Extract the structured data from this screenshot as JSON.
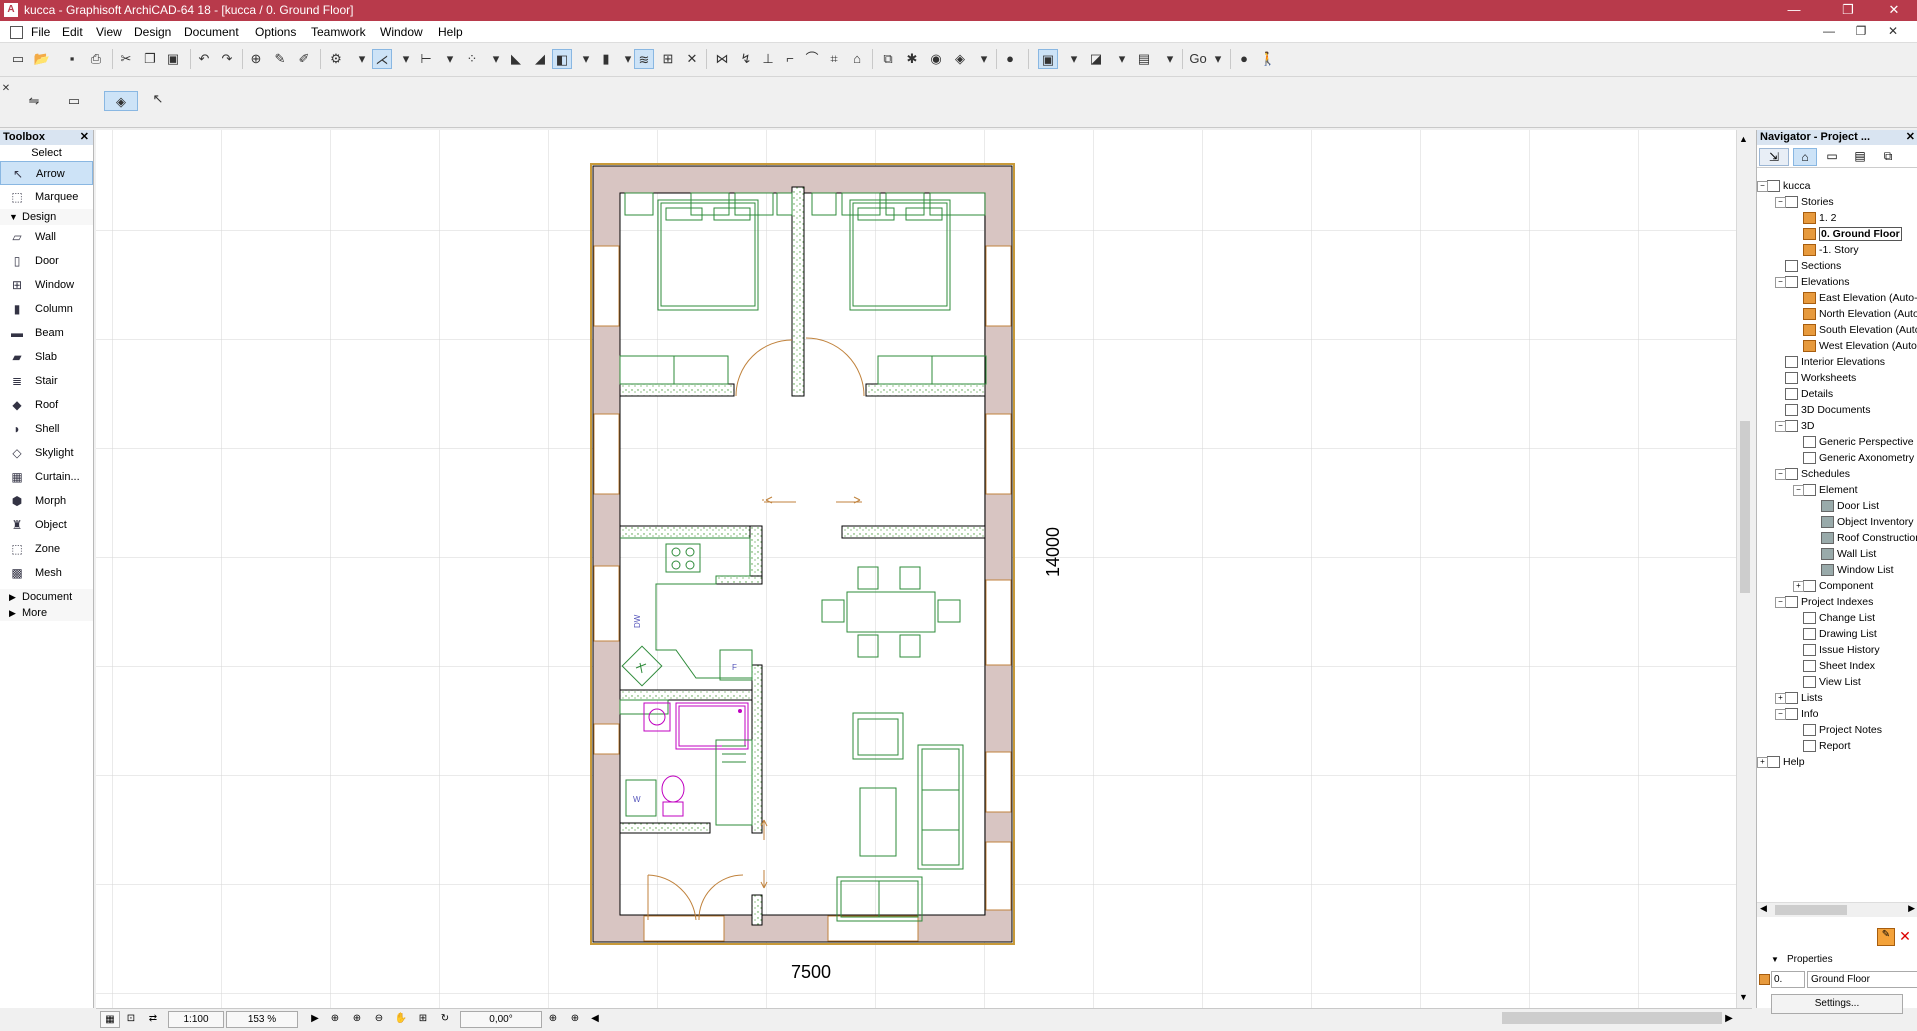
{
  "window": {
    "title": "kucca - Graphisoft ArchiCAD-64 18 - [kucca / 0. Ground Floor]",
    "app_icon": "archicad-logo-icon",
    "minimize": "—",
    "restore": "❐",
    "close": "✕"
  },
  "menu": [
    "File",
    "Edit",
    "View",
    "Design",
    "Document",
    "Options",
    "Teamwork",
    "Window",
    "Help"
  ],
  "mdi": {
    "minimize": "—",
    "restore": "❐",
    "close": "✕"
  },
  "toolbar": {
    "go_label": "Go"
  },
  "toolbox": {
    "header": "Toolbox",
    "select_label": "Select",
    "select_tools": [
      {
        "label": "Arrow",
        "icon": "arrow-icon",
        "selected": true
      },
      {
        "label": "Marquee",
        "icon": "marquee-icon",
        "selected": false
      }
    ],
    "design_group": "Design",
    "design_tools": [
      {
        "label": "Wall",
        "icon": "wall-icon"
      },
      {
        "label": "Door",
        "icon": "door-icon"
      },
      {
        "label": "Window",
        "icon": "window-icon"
      },
      {
        "label": "Column",
        "icon": "column-icon"
      },
      {
        "label": "Beam",
        "icon": "beam-icon"
      },
      {
        "label": "Slab",
        "icon": "slab-icon"
      },
      {
        "label": "Stair",
        "icon": "stair-icon"
      },
      {
        "label": "Roof",
        "icon": "roof-icon"
      },
      {
        "label": "Shell",
        "icon": "shell-icon"
      },
      {
        "label": "Skylight",
        "icon": "skylight-icon"
      },
      {
        "label": "Curtain...",
        "icon": "curtain-wall-icon"
      },
      {
        "label": "Morph",
        "icon": "morph-icon"
      },
      {
        "label": "Object",
        "icon": "object-icon"
      },
      {
        "label": "Zone",
        "icon": "zone-icon"
      },
      {
        "label": "Mesh",
        "icon": "mesh-icon"
      }
    ],
    "document_group": "Document",
    "more_group": "More"
  },
  "plan": {
    "dim_width": "7500",
    "dim_height": "14000",
    "label_dw": "DW",
    "label_f": "F",
    "label_w": "W"
  },
  "status": {
    "scale": "1:100",
    "zoom": "153 %",
    "angle": "0,00°"
  },
  "navigator": {
    "header": "Navigator - Project ...",
    "tree": [
      {
        "label": "kucca",
        "level": 0,
        "expanded": true
      },
      {
        "label": "Stories",
        "level": 1,
        "expanded": true
      },
      {
        "label": "1. 2",
        "level": 2,
        "icon": "story"
      },
      {
        "label": "0. Ground Floor",
        "level": 2,
        "icon": "story",
        "current": true
      },
      {
        "label": "-1. Story",
        "level": 2,
        "icon": "story"
      },
      {
        "label": "Sections",
        "level": 1
      },
      {
        "label": "Elevations",
        "level": 1,
        "expanded": true
      },
      {
        "label": "East Elevation (Auto-rebuild Model)",
        "level": 2,
        "icon": "elev"
      },
      {
        "label": "North Elevation (Auto-rebuild Model)",
        "level": 2,
        "icon": "elev"
      },
      {
        "label": "South Elevation (Auto-rebuild Model)",
        "level": 2,
        "icon": "elev"
      },
      {
        "label": "West Elevation (Auto-rebuild Model)",
        "level": 2,
        "icon": "elev"
      },
      {
        "label": "Interior Elevations",
        "level": 1
      },
      {
        "label": "Worksheets",
        "level": 1
      },
      {
        "label": "Details",
        "level": 1
      },
      {
        "label": "3D Documents",
        "level": 1
      },
      {
        "label": "3D",
        "level": 1,
        "expanded": true
      },
      {
        "label": "Generic Perspective",
        "level": 2
      },
      {
        "label": "Generic Axonometry",
        "level": 2
      },
      {
        "label": "Schedules",
        "level": 1,
        "expanded": true
      },
      {
        "label": "Element",
        "level": 2,
        "expanded": true
      },
      {
        "label": "Door List",
        "level": 3,
        "icon": "sched"
      },
      {
        "label": "Object Inventory",
        "level": 3,
        "icon": "sched"
      },
      {
        "label": "Roof Construction",
        "level": 3,
        "icon": "sched"
      },
      {
        "label": "Wall List",
        "level": 3,
        "icon": "sched"
      },
      {
        "label": "Window List",
        "level": 3,
        "icon": "sched"
      },
      {
        "label": "Component",
        "level": 2,
        "collapsed": true
      },
      {
        "label": "Project Indexes",
        "level": 1,
        "expanded": true
      },
      {
        "label": "Change List",
        "level": 2
      },
      {
        "label": "Drawing List",
        "level": 2
      },
      {
        "label": "Issue History",
        "level": 2
      },
      {
        "label": "Sheet Index",
        "level": 2
      },
      {
        "label": "View List",
        "level": 2
      },
      {
        "label": "Lists",
        "level": 1,
        "collapsed": true
      },
      {
        "label": "Info",
        "level": 1,
        "expanded": true
      },
      {
        "label": "Project Notes",
        "level": 2
      },
      {
        "label": "Report",
        "level": 2
      },
      {
        "label": "Help",
        "level": 0,
        "collapsed": true
      }
    ],
    "properties_label": "Properties",
    "story_number": "0.",
    "story_name": "Ground Floor",
    "settings_label": "Settings..."
  }
}
